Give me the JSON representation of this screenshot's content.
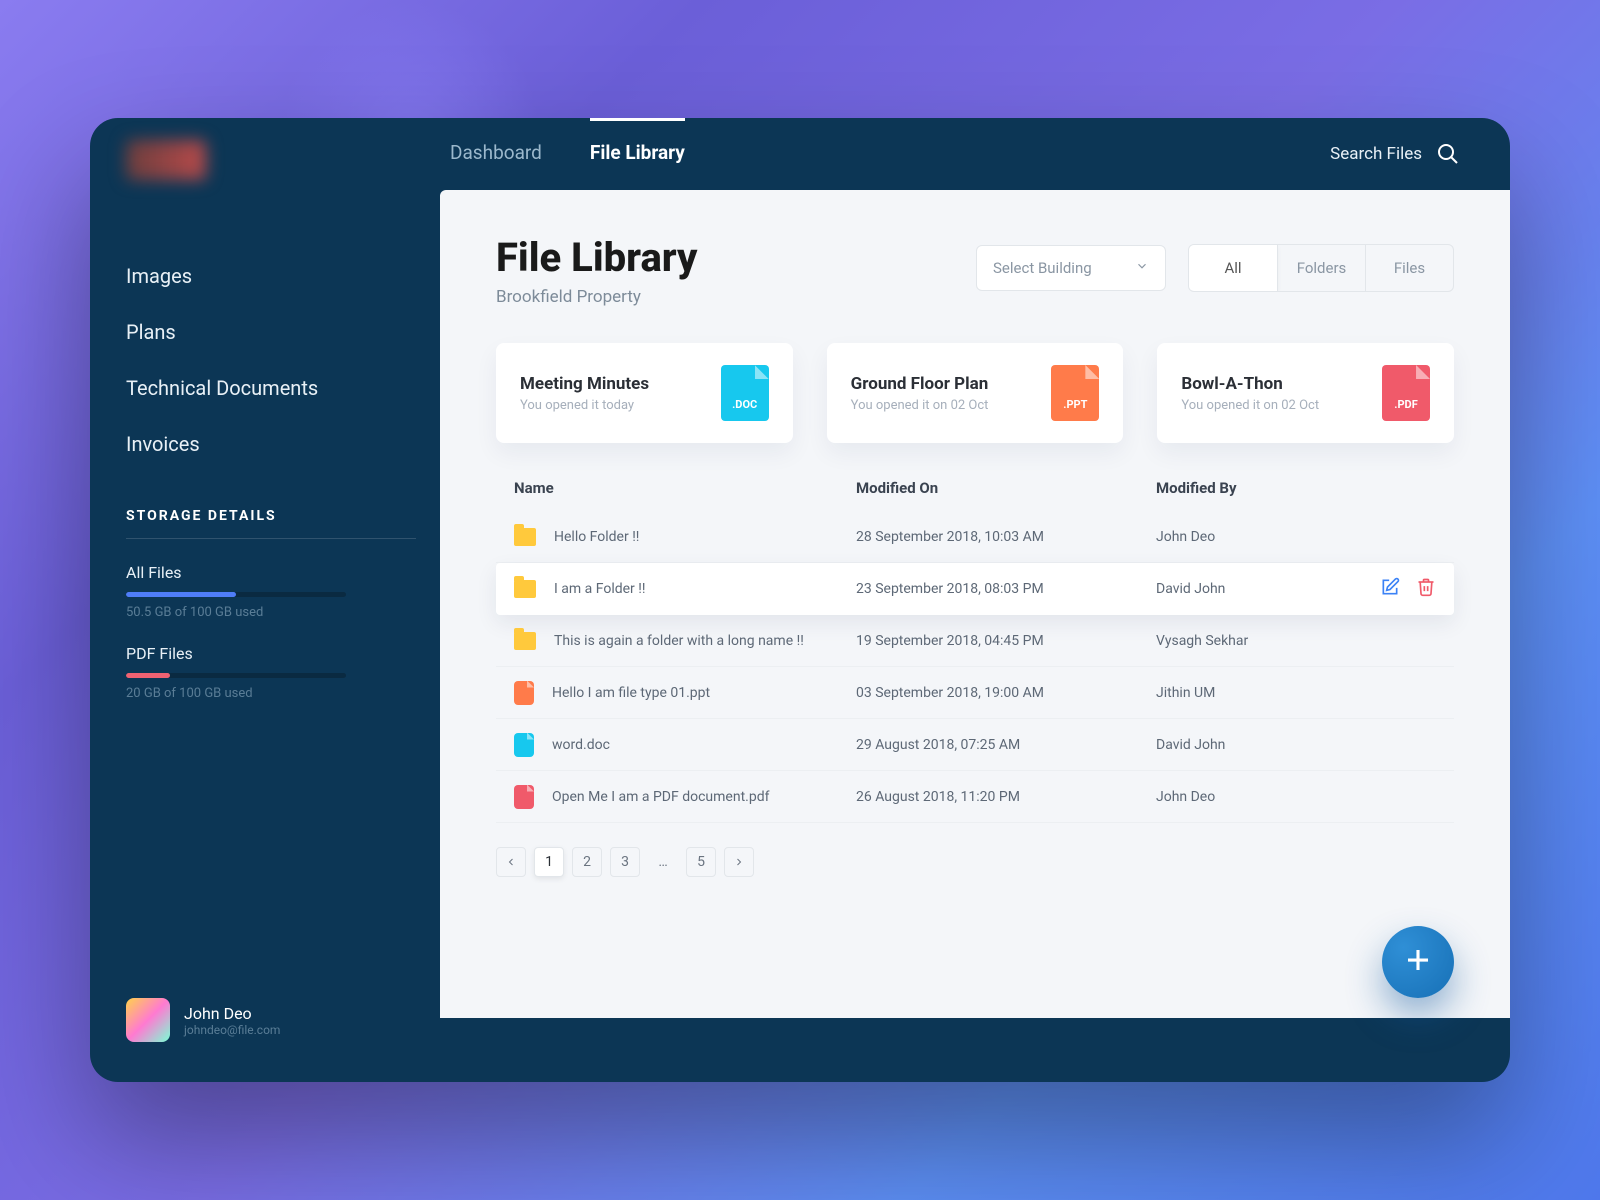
{
  "header": {
    "tabs": [
      {
        "label": "Dashboard",
        "active": false
      },
      {
        "label": "File Library",
        "active": true
      }
    ],
    "search_label": "Search Files"
  },
  "sidebar": {
    "nav": [
      "Images",
      "Plans",
      "Technical Documents",
      "Invoices"
    ],
    "storage_heading": "STORAGE DETAILS",
    "storage": [
      {
        "label": "All Files",
        "caption": "50.5 GB of 100 GB used",
        "color": "blue",
        "percent": 50
      },
      {
        "label": "PDF Files",
        "caption": "20 GB of 100 GB used",
        "color": "red",
        "percent": 20
      }
    ]
  },
  "user": {
    "name": "John Deo",
    "email": "johndeo@file.com"
  },
  "page": {
    "title": "File Library",
    "subtitle": "Brookfield Property"
  },
  "select_placeholder": "Select Building",
  "segments": [
    "All",
    "Folders",
    "Files"
  ],
  "segment_active": "All",
  "cards": [
    {
      "title": "Meeting Minutes",
      "subtitle": "You opened it today",
      "ext": ".DOC",
      "cls": "fi-doc"
    },
    {
      "title": "Ground Floor Plan",
      "subtitle": "You opened it on 02 Oct",
      "ext": ".PPT",
      "cls": "fi-ppt"
    },
    {
      "title": "Bowl-A-Thon",
      "subtitle": "You opened it on 02 Oct",
      "ext": ".PDF",
      "cls": "fi-pdf"
    }
  ],
  "table": {
    "columns": [
      "Name",
      "Modified On",
      "Modified By"
    ],
    "rows": [
      {
        "icon": "folder",
        "name": "Hello Folder !!",
        "modified_on": "28 September 2018, 10:03 AM",
        "modified_by": "John Deo",
        "selected": false
      },
      {
        "icon": "folder",
        "name": "I am a Folder !!",
        "modified_on": "23 September 2018, 08:03 PM",
        "modified_by": "David John",
        "selected": true
      },
      {
        "icon": "folder",
        "name": "This is again a folder with a long name !!",
        "modified_on": "19 September 2018, 04:45 PM",
        "modified_by": "Vysagh Sekhar",
        "selected": false
      },
      {
        "icon": "ppt",
        "name": "Hello I am file type 01.ppt",
        "modified_on": "03 September 2018, 19:00 AM",
        "modified_by": "Jithin UM",
        "selected": false
      },
      {
        "icon": "doc",
        "name": "word.doc",
        "modified_on": "29 August 2018, 07:25 AM",
        "modified_by": "David John",
        "selected": false
      },
      {
        "icon": "pdf",
        "name": "Open Me I am a PDF document.pdf",
        "modified_on": "26 August 2018, 11:20 PM",
        "modified_by": "John Deo",
        "selected": false
      }
    ]
  },
  "pagination": {
    "pages": [
      "1",
      "2",
      "3",
      "…",
      "5"
    ],
    "active": "1"
  }
}
